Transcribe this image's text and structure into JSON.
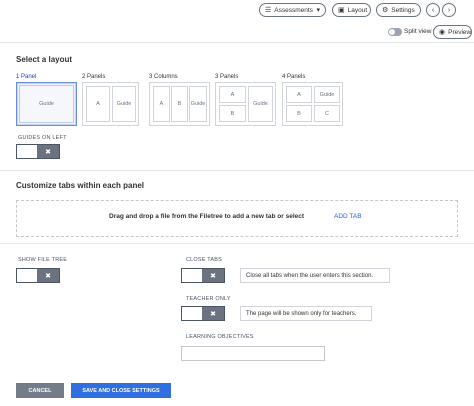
{
  "toolbar": {
    "assessments_label": "Assessments",
    "layout_label": "Layout",
    "settings_label": "Settings",
    "split_view_label": "Split view",
    "preview_label": "Preview"
  },
  "layout_section": {
    "heading": "Select a layout",
    "options": [
      {
        "label": "1 Panel",
        "cells": [
          "Guide"
        ],
        "selected": true
      },
      {
        "label": "2 Panels",
        "cells": [
          "A",
          "Guide"
        ],
        "selected": false
      },
      {
        "label": "3 Columns",
        "cells": [
          "A",
          "B",
          "Guide"
        ],
        "selected": false
      },
      {
        "label": "3 Panels",
        "cells": [
          "A",
          "B",
          "Guide"
        ],
        "selected": false
      },
      {
        "label": "4 Panels",
        "cells": [
          "A",
          "B",
          "Guide",
          "C"
        ],
        "selected": false
      }
    ],
    "guides_on_left_label": "GUIDES ON LEFT",
    "guides_on_left": false
  },
  "tabs_section": {
    "heading": "Customize tabs within each panel",
    "drop_text": "Drag and drop a file from the Filetree to add a new tab or select",
    "add_tab_label": "ADD TAB"
  },
  "settings": {
    "show_file_tree_label": "SHOW FILE TREE",
    "show_file_tree": false,
    "close_tabs_label": "CLOSE TABS",
    "close_tabs": false,
    "close_tabs_desc": "Close all tabs when the user enters this section.",
    "teacher_only_label": "TEACHER ONLY",
    "teacher_only": false,
    "teacher_only_desc": "The page will be shown only for teachers.",
    "learning_objectives_label": "LEARNING OBJECTIVES",
    "learning_objectives_value": ""
  },
  "footer": {
    "cancel_label": "CANCEL",
    "save_label": "SAVE AND CLOSE SETTINGS"
  }
}
